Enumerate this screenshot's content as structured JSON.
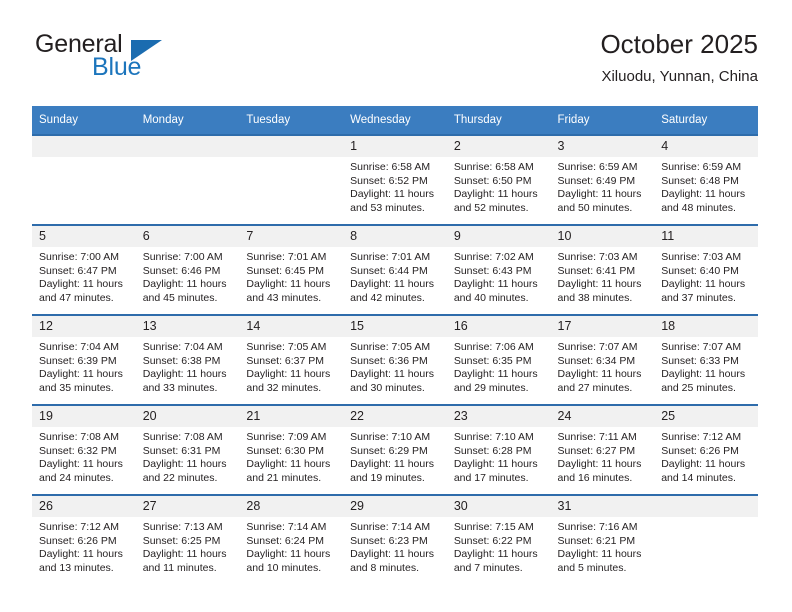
{
  "brand": {
    "name_part1": "General",
    "name_part2": "Blue",
    "accent_color": "#1c75bc",
    "triangle_color": "#1b6cb0"
  },
  "header": {
    "title": "October 2025",
    "subtitle": "Xiluodu, Yunnan, China"
  },
  "theme": {
    "header_row_bg": "#3b7dc0",
    "row_divider": "#2e6cab",
    "daynum_bg": "#f1f1f1",
    "text_color": "#231f20"
  },
  "weekdays": [
    "Sunday",
    "Monday",
    "Tuesday",
    "Wednesday",
    "Thursday",
    "Friday",
    "Saturday"
  ],
  "labels": {
    "sunrise_prefix": "Sunrise:",
    "sunset_prefix": "Sunset:",
    "daylight_prefix": "Daylight:"
  },
  "weeks": [
    [
      {
        "day": "",
        "empty": true,
        "line1": "",
        "line2": "",
        "line3": "",
        "line4": ""
      },
      {
        "day": "",
        "empty": true,
        "line1": "",
        "line2": "",
        "line3": "",
        "line4": ""
      },
      {
        "day": "",
        "empty": true,
        "line1": "",
        "line2": "",
        "line3": "",
        "line4": ""
      },
      {
        "day": "1",
        "empty": false,
        "line1": "Sunrise: 6:58 AM",
        "line2": "Sunset: 6:52 PM",
        "line3": "Daylight: 11 hours",
        "line4": "and 53 minutes."
      },
      {
        "day": "2",
        "empty": false,
        "line1": "Sunrise: 6:58 AM",
        "line2": "Sunset: 6:50 PM",
        "line3": "Daylight: 11 hours",
        "line4": "and 52 minutes."
      },
      {
        "day": "3",
        "empty": false,
        "line1": "Sunrise: 6:59 AM",
        "line2": "Sunset: 6:49 PM",
        "line3": "Daylight: 11 hours",
        "line4": "and 50 minutes."
      },
      {
        "day": "4",
        "empty": false,
        "line1": "Sunrise: 6:59 AM",
        "line2": "Sunset: 6:48 PM",
        "line3": "Daylight: 11 hours",
        "line4": "and 48 minutes."
      }
    ],
    [
      {
        "day": "5",
        "empty": false,
        "line1": "Sunrise: 7:00 AM",
        "line2": "Sunset: 6:47 PM",
        "line3": "Daylight: 11 hours",
        "line4": "and 47 minutes."
      },
      {
        "day": "6",
        "empty": false,
        "line1": "Sunrise: 7:00 AM",
        "line2": "Sunset: 6:46 PM",
        "line3": "Daylight: 11 hours",
        "line4": "and 45 minutes."
      },
      {
        "day": "7",
        "empty": false,
        "line1": "Sunrise: 7:01 AM",
        "line2": "Sunset: 6:45 PM",
        "line3": "Daylight: 11 hours",
        "line4": "and 43 minutes."
      },
      {
        "day": "8",
        "empty": false,
        "line1": "Sunrise: 7:01 AM",
        "line2": "Sunset: 6:44 PM",
        "line3": "Daylight: 11 hours",
        "line4": "and 42 minutes."
      },
      {
        "day": "9",
        "empty": false,
        "line1": "Sunrise: 7:02 AM",
        "line2": "Sunset: 6:43 PM",
        "line3": "Daylight: 11 hours",
        "line4": "and 40 minutes."
      },
      {
        "day": "10",
        "empty": false,
        "line1": "Sunrise: 7:03 AM",
        "line2": "Sunset: 6:41 PM",
        "line3": "Daylight: 11 hours",
        "line4": "and 38 minutes."
      },
      {
        "day": "11",
        "empty": false,
        "line1": "Sunrise: 7:03 AM",
        "line2": "Sunset: 6:40 PM",
        "line3": "Daylight: 11 hours",
        "line4": "and 37 minutes."
      }
    ],
    [
      {
        "day": "12",
        "empty": false,
        "line1": "Sunrise: 7:04 AM",
        "line2": "Sunset: 6:39 PM",
        "line3": "Daylight: 11 hours",
        "line4": "and 35 minutes."
      },
      {
        "day": "13",
        "empty": false,
        "line1": "Sunrise: 7:04 AM",
        "line2": "Sunset: 6:38 PM",
        "line3": "Daylight: 11 hours",
        "line4": "and 33 minutes."
      },
      {
        "day": "14",
        "empty": false,
        "line1": "Sunrise: 7:05 AM",
        "line2": "Sunset: 6:37 PM",
        "line3": "Daylight: 11 hours",
        "line4": "and 32 minutes."
      },
      {
        "day": "15",
        "empty": false,
        "line1": "Sunrise: 7:05 AM",
        "line2": "Sunset: 6:36 PM",
        "line3": "Daylight: 11 hours",
        "line4": "and 30 minutes."
      },
      {
        "day": "16",
        "empty": false,
        "line1": "Sunrise: 7:06 AM",
        "line2": "Sunset: 6:35 PM",
        "line3": "Daylight: 11 hours",
        "line4": "and 29 minutes."
      },
      {
        "day": "17",
        "empty": false,
        "line1": "Sunrise: 7:07 AM",
        "line2": "Sunset: 6:34 PM",
        "line3": "Daylight: 11 hours",
        "line4": "and 27 minutes."
      },
      {
        "day": "18",
        "empty": false,
        "line1": "Sunrise: 7:07 AM",
        "line2": "Sunset: 6:33 PM",
        "line3": "Daylight: 11 hours",
        "line4": "and 25 minutes."
      }
    ],
    [
      {
        "day": "19",
        "empty": false,
        "line1": "Sunrise: 7:08 AM",
        "line2": "Sunset: 6:32 PM",
        "line3": "Daylight: 11 hours",
        "line4": "and 24 minutes."
      },
      {
        "day": "20",
        "empty": false,
        "line1": "Sunrise: 7:08 AM",
        "line2": "Sunset: 6:31 PM",
        "line3": "Daylight: 11 hours",
        "line4": "and 22 minutes."
      },
      {
        "day": "21",
        "empty": false,
        "line1": "Sunrise: 7:09 AM",
        "line2": "Sunset: 6:30 PM",
        "line3": "Daylight: 11 hours",
        "line4": "and 21 minutes."
      },
      {
        "day": "22",
        "empty": false,
        "line1": "Sunrise: 7:10 AM",
        "line2": "Sunset: 6:29 PM",
        "line3": "Daylight: 11 hours",
        "line4": "and 19 minutes."
      },
      {
        "day": "23",
        "empty": false,
        "line1": "Sunrise: 7:10 AM",
        "line2": "Sunset: 6:28 PM",
        "line3": "Daylight: 11 hours",
        "line4": "and 17 minutes."
      },
      {
        "day": "24",
        "empty": false,
        "line1": "Sunrise: 7:11 AM",
        "line2": "Sunset: 6:27 PM",
        "line3": "Daylight: 11 hours",
        "line4": "and 16 minutes."
      },
      {
        "day": "25",
        "empty": false,
        "line1": "Sunrise: 7:12 AM",
        "line2": "Sunset: 6:26 PM",
        "line3": "Daylight: 11 hours",
        "line4": "and 14 minutes."
      }
    ],
    [
      {
        "day": "26",
        "empty": false,
        "line1": "Sunrise: 7:12 AM",
        "line2": "Sunset: 6:26 PM",
        "line3": "Daylight: 11 hours",
        "line4": "and 13 minutes."
      },
      {
        "day": "27",
        "empty": false,
        "line1": "Sunrise: 7:13 AM",
        "line2": "Sunset: 6:25 PM",
        "line3": "Daylight: 11 hours",
        "line4": "and 11 minutes."
      },
      {
        "day": "28",
        "empty": false,
        "line1": "Sunrise: 7:14 AM",
        "line2": "Sunset: 6:24 PM",
        "line3": "Daylight: 11 hours",
        "line4": "and 10 minutes."
      },
      {
        "day": "29",
        "empty": false,
        "line1": "Sunrise: 7:14 AM",
        "line2": "Sunset: 6:23 PM",
        "line3": "Daylight: 11 hours",
        "line4": "and 8 minutes."
      },
      {
        "day": "30",
        "empty": false,
        "line1": "Sunrise: 7:15 AM",
        "line2": "Sunset: 6:22 PM",
        "line3": "Daylight: 11 hours",
        "line4": "and 7 minutes."
      },
      {
        "day": "31",
        "empty": false,
        "line1": "Sunrise: 7:16 AM",
        "line2": "Sunset: 6:21 PM",
        "line3": "Daylight: 11 hours",
        "line4": "and 5 minutes."
      },
      {
        "day": "",
        "empty": true,
        "line1": "",
        "line2": "",
        "line3": "",
        "line4": ""
      }
    ]
  ]
}
